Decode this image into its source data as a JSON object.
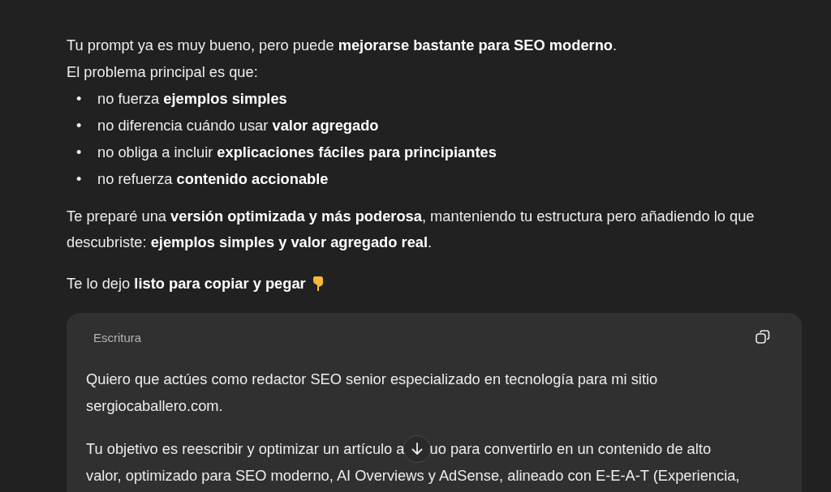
{
  "message": {
    "intro": [
      "Tu prompt ya es muy bueno, pero puede **mejorarse bastante para SEO moderno**.",
      "El problema principal es que:"
    ],
    "bullets": [
      {
        "marker": "•",
        "text": "no fuerza **ejemplos simples**"
      },
      {
        "marker": "•",
        "text": "no diferencia cuándo usar **valor agregado**"
      },
      {
        "marker": "•",
        "text": "no obliga a incluir **explicaciones fáciles para principiantes**"
      },
      {
        "marker": "•",
        "text": "no refuerza **contenido accionable**"
      }
    ],
    "summary": "Te preparé una **versión optimizada y más poderosa**, manteniendo tu estructura pero añadiendo lo que descubriste: **ejemplos simples y valor agregado real**.",
    "handoff": "Te lo dejo **listo para copiar y pegar**"
  },
  "code_block": {
    "label": "Escritura",
    "paragraphs": [
      "Quiero que actúes como redactor SEO senior especializado en tecnología para mi sitio sergiocaballero.com."
    ],
    "partly_covered_paragraph": {
      "before_button": "Tu objetivo es reescribir y optimizar un artículo a",
      "after_button": "uo para convertirlo en un contenido de alto",
      "next_line": "valor, optimizado para SEO moderno, AI Overviews y AdSense, alineado con E-E-A-T (Experiencia,"
    }
  }
}
